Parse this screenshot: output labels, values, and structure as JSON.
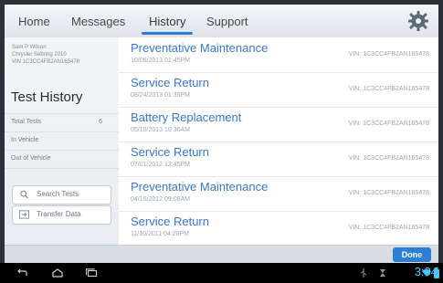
{
  "tabs": [
    {
      "label": "Home"
    },
    {
      "label": "Messages"
    },
    {
      "label": "History"
    },
    {
      "label": "Support"
    }
  ],
  "sidebar": {
    "user_name": "Sam P Wilson",
    "vehicle_line": "Chrysler Sebring 2010",
    "vin_line": "VIN 1C3CC4FB2AN165478",
    "title": "Test History",
    "items": [
      {
        "label": "Total Tests",
        "count": "6"
      },
      {
        "label": "In Vehicle",
        "count": ""
      },
      {
        "label": "Out of Vehicle",
        "count": ""
      }
    ],
    "search_label": "Search Tests",
    "transfer_label": "Transfer Data"
  },
  "history_rows": [
    {
      "title": "Preventative Maintenance",
      "date": "10/06/2013  01:45PM",
      "vin": "VIN: 1C3CC4FB2AN165478"
    },
    {
      "title": "Service Return",
      "date": "08/24/2013  01:35PM",
      "vin": "VIN: 1C3CC4FB2AN165478"
    },
    {
      "title": "Battery Replacement",
      "date": "05/10/2013  10:30AM",
      "vin": "VIN: 1C3CC4FB2AN165478"
    },
    {
      "title": "Service Return",
      "date": "07/01/2012  12:45PM",
      "vin": "VIN: 1C3CC4FB2AN165478"
    },
    {
      "title": "Preventative Maintenance",
      "date": "04/16/2012  09:08AM",
      "vin": "VIN: 1C3CC4FB2AN165478"
    },
    {
      "title": "Service Return",
      "date": "11/10/2011  04:28PM",
      "vin": "VIN: 1C3CC4FB2AN165478"
    }
  ],
  "bottom": {
    "done_label": "Done"
  },
  "status": {
    "time": "3:04"
  },
  "colors": {
    "accent": "#2e7ed5",
    "link": "#3b78c7",
    "status": "#45c8ff"
  },
  "icons": [
    "gear-icon",
    "search-icon",
    "transfer-icon",
    "back-icon",
    "home-icon",
    "recent-apps-icon",
    "usb-icon",
    "wifi-icon",
    "battery-icon"
  ]
}
